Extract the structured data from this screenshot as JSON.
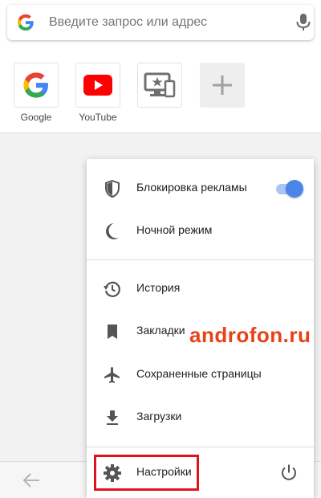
{
  "search": {
    "placeholder": "Введите запрос или адрес",
    "left_icon": "google-g-icon",
    "right_icon": "microphone-icon"
  },
  "speed_dial": {
    "tiles": [
      {
        "label": "Google",
        "icon": "google-logo-icon"
      },
      {
        "label": "YouTube",
        "icon": "youtube-logo-icon"
      },
      {
        "label": "",
        "icon": "desktop-mobile-star-icon"
      },
      {
        "label": "",
        "icon": "plus-icon"
      }
    ]
  },
  "menu": {
    "items": [
      {
        "label": "Блокировка рекламы",
        "icon": "shield-icon",
        "toggle_on": true
      },
      {
        "label": "Ночной режим",
        "icon": "moon-icon"
      },
      {
        "label": "История",
        "icon": "history-icon"
      },
      {
        "label": "Закладки",
        "icon": "bookmark-icon"
      },
      {
        "label": "Сохраненные страницы",
        "icon": "airplane-icon"
      },
      {
        "label": "Загрузки",
        "icon": "download-icon"
      },
      {
        "label": "Настройки",
        "icon": "gear-icon"
      }
    ],
    "power_icon": "power-icon"
  },
  "bottom_bar": {
    "back_icon": "back-arrow-icon"
  },
  "watermark": {
    "text": "androfon.ru"
  },
  "colors": {
    "accent": "#4a86e8",
    "highlight": "#e0141e",
    "watermark": "#e8411a",
    "youtube_red": "#ff0000"
  }
}
